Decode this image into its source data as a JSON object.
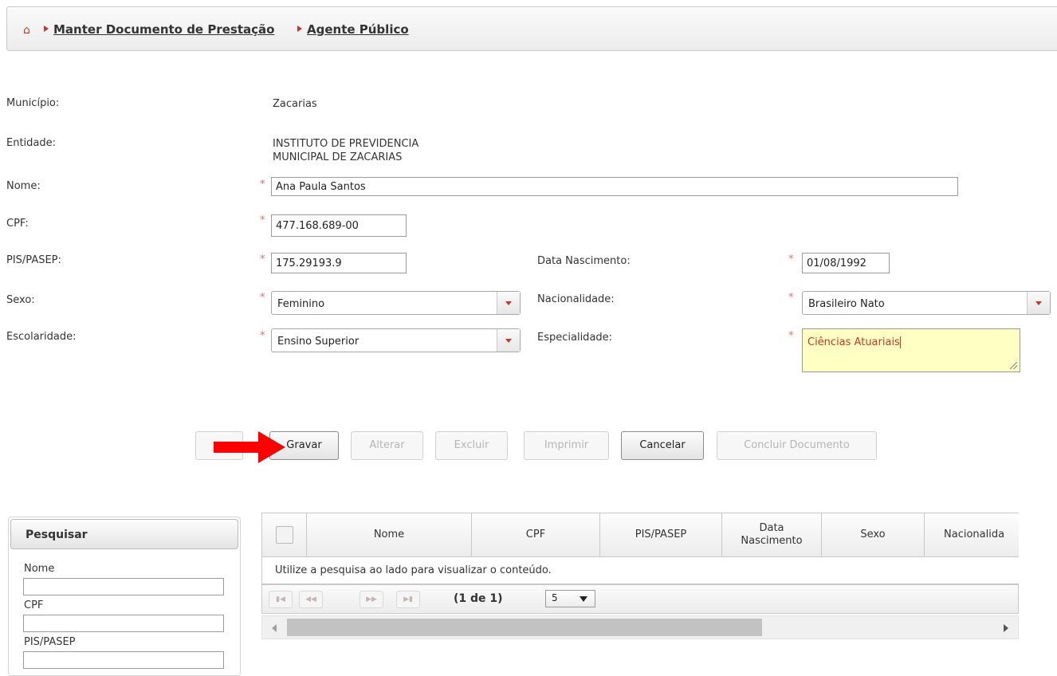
{
  "breadcrumb": {
    "items": [
      "Manter Documento de Prestação",
      "Agente Público"
    ]
  },
  "form": {
    "municipio": {
      "label": "Município:",
      "value": "Zacarias"
    },
    "entidade": {
      "label": "Entidade:",
      "value_line1": "INSTITUTO DE PREVIDENCIA",
      "value_line2": "MUNICIPAL DE ZACARIAS"
    },
    "nome": {
      "label": "Nome:",
      "value": "Ana Paula Santos"
    },
    "cpf": {
      "label": "CPF:",
      "value": "477.168.689-00"
    },
    "pis_pasep": {
      "label": "PIS/PASEP:",
      "value": "175.29193.9"
    },
    "data_nascimento": {
      "label": "Data Nascimento:",
      "value": "01/08/1992"
    },
    "sexo": {
      "label": "Sexo:",
      "value": "Feminino"
    },
    "nacionalidade": {
      "label": "Nacionalidade:",
      "value": "Brasileiro Nato"
    },
    "escolaridade": {
      "label": "Escolaridade:",
      "value": "Ensino Superior"
    },
    "especialidade": {
      "label": "Especialidade:",
      "value": "Ciências Atuariais"
    },
    "required_marker": "*"
  },
  "toolbar": {
    "gravar": "Gravar",
    "alterar": "Alterar",
    "excluir": "Excluir",
    "imprimir": "Imprimir",
    "cancelar": "Cancelar",
    "concluir": "Concluir Documento"
  },
  "search": {
    "title": "Pesquisar",
    "fields": [
      "Nome",
      "CPF",
      "PIS/PASEP"
    ]
  },
  "table": {
    "columns": [
      "Nome",
      "CPF",
      "PIS/PASEP",
      "Data Nascimento",
      "Sexo",
      "Nacionalida"
    ],
    "empty_message": "Utilize a pesquisa ao lado para visualizar o conteúdo.",
    "page_report": "(1 de 1)",
    "rows_per_page": "5"
  },
  "colors": {
    "accent": "#c0392b",
    "highlight_field": "#ffffc4",
    "arrow": "#ff0000"
  }
}
